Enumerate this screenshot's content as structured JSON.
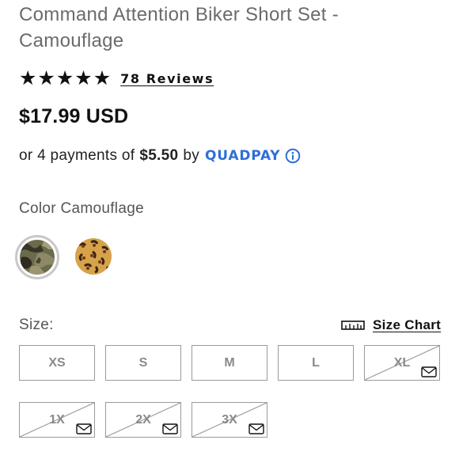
{
  "product": {
    "title": "Command Attention Biker Short Set - Camouflage",
    "rating": 5,
    "reviews_label": "78 Reviews",
    "price": "$17.99 USD"
  },
  "installments": {
    "prefix": "or 4 payments of",
    "amount": "$5.50",
    "by": "by",
    "provider": "QUADPAY",
    "brand_color": "#2f6fd8"
  },
  "color": {
    "label": "Color Camouflage",
    "swatches": [
      {
        "name": "Camouflage",
        "selected": true
      },
      {
        "name": "Leopard",
        "selected": false
      }
    ]
  },
  "size": {
    "label": "Size:",
    "chart_label": "Size Chart",
    "options": [
      {
        "label": "XS",
        "available": true
      },
      {
        "label": "S",
        "available": true
      },
      {
        "label": "M",
        "available": true
      },
      {
        "label": "L",
        "available": true
      },
      {
        "label": "XL",
        "available": false
      },
      {
        "label": "1X",
        "available": false
      },
      {
        "label": "2X",
        "available": false
      },
      {
        "label": "3X",
        "available": false
      }
    ]
  }
}
